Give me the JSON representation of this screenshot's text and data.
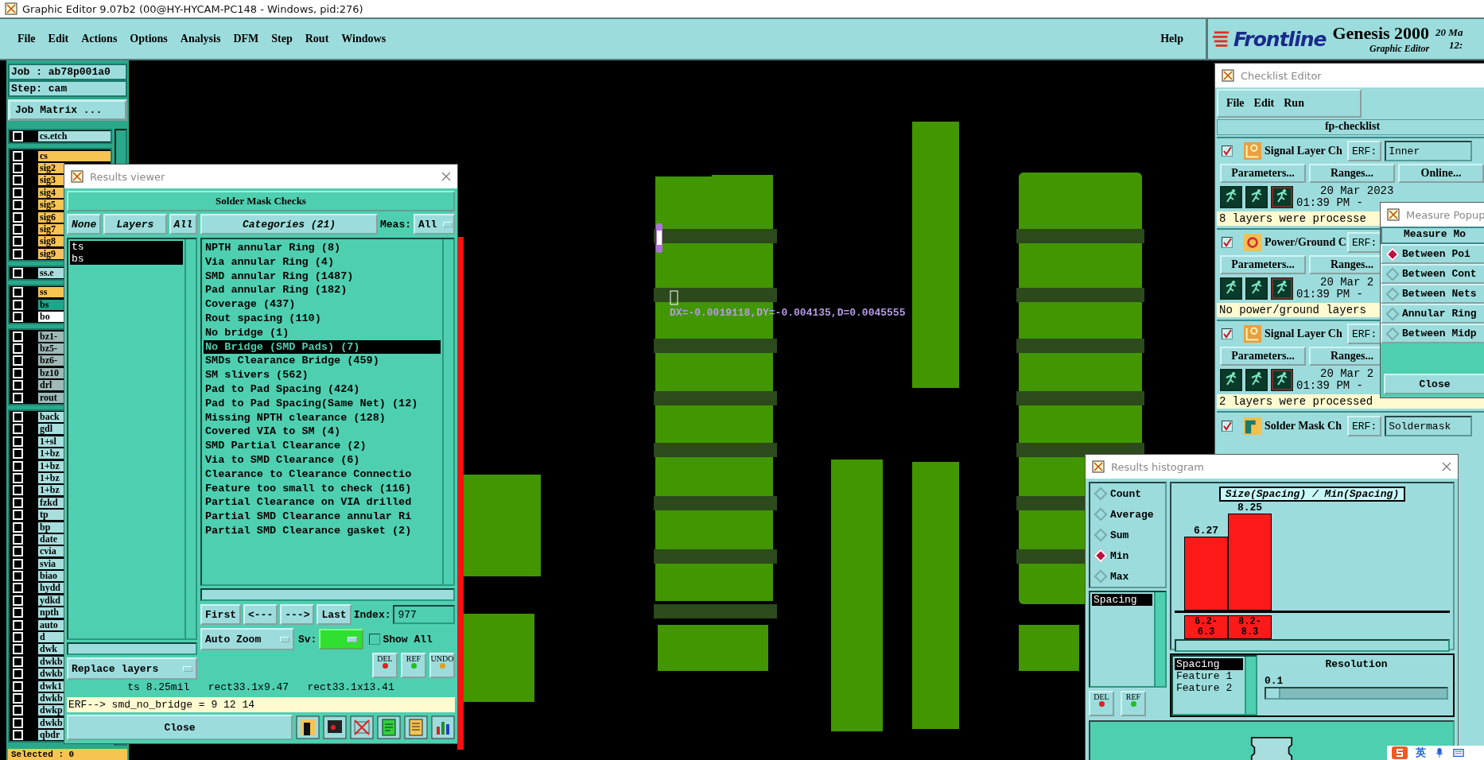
{
  "window": {
    "title": "Graphic Editor 9.07b2 (00@HY-HYCAM-PC148 - Windows, pid:276)"
  },
  "menu": [
    "File",
    "Edit",
    "Actions",
    "Options",
    "Analysis",
    "DFM",
    "Step",
    "Rout",
    "Windows"
  ],
  "help": "Help",
  "brand": {
    "logo": "Frontline",
    "product": "Genesis 2000",
    "subtitle": "Graphic Editor",
    "date": "20 Ma",
    "time": "12:"
  },
  "job": {
    "job": "Job : ab78p001a0",
    "step": "Step: cam",
    "matrix": "Job Matrix ..."
  },
  "layer_groups": [
    {
      "layers": [
        {
          "name": "cs.etch",
          "color": "#a8dede",
          "checked": false
        }
      ]
    },
    {
      "layers": [
        {
          "name": "cs",
          "color": "#f7c452",
          "checked": false
        },
        {
          "name": "sig2",
          "color": "#f7c452",
          "checked": false
        },
        {
          "name": "sig3",
          "color": "#f7c452",
          "checked": false
        },
        {
          "name": "sig4",
          "color": "#f7c452",
          "checked": false
        },
        {
          "name": "sig5",
          "color": "#f7c452",
          "checked": false
        },
        {
          "name": "sig6",
          "color": "#f7c452",
          "checked": false
        },
        {
          "name": "sig7",
          "color": "#f7c452",
          "checked": false
        },
        {
          "name": "sig8",
          "color": "#f7c452",
          "checked": false
        },
        {
          "name": "sig9",
          "color": "#f7c452",
          "checked": false
        }
      ]
    },
    {
      "layers": [
        {
          "name": "ss.e",
          "color": "#a8dede",
          "checked": false
        }
      ]
    },
    {
      "layers": [
        {
          "name": "ss",
          "color": "#f7c452",
          "checked": false
        },
        {
          "name": "bs",
          "color": "#1fa58a",
          "checked": false
        },
        {
          "name": "bo",
          "color": "#ffffff",
          "checked": false
        }
      ]
    },
    {
      "layers": [
        {
          "name": "bz1-",
          "color": "#9fb8b8",
          "checked": false
        },
        {
          "name": "bz5-",
          "color": "#9fb8b8",
          "checked": false
        },
        {
          "name": "bz6-",
          "color": "#9fb8b8",
          "checked": false
        },
        {
          "name": "bz10",
          "color": "#9fb8b8",
          "checked": false
        },
        {
          "name": "drl",
          "color": "#9fb8b8",
          "checked": false
        },
        {
          "name": "rout",
          "color": "#9fb8b8",
          "checked": false
        }
      ]
    },
    {
      "layers": [
        {
          "name": "back",
          "color": "#a8dede",
          "checked": false
        },
        {
          "name": "gdl",
          "color": "#a8dede",
          "checked": false
        },
        {
          "name": "1+sl",
          "color": "#a8dede",
          "checked": false
        },
        {
          "name": "1+bz",
          "color": "#a8dede",
          "checked": false
        },
        {
          "name": "1+bz",
          "color": "#a8dede",
          "checked": false
        },
        {
          "name": "1+bz",
          "color": "#a8dede",
          "checked": false
        },
        {
          "name": "1+bz",
          "color": "#a8dede",
          "checked": false
        },
        {
          "name": "fzkd",
          "color": "#a8dede",
          "checked": false
        },
        {
          "name": "tp",
          "color": "#a8dede",
          "checked": false
        },
        {
          "name": "bp",
          "color": "#a8dede",
          "checked": false
        },
        {
          "name": "date",
          "color": "#a8dede",
          "checked": false
        },
        {
          "name": "cvia",
          "color": "#a8dede",
          "checked": false
        },
        {
          "name": "svia",
          "color": "#a8dede",
          "checked": false
        },
        {
          "name": "biao",
          "color": "#a8dede",
          "checked": false
        },
        {
          "name": "hydd",
          "color": "#a8dede",
          "checked": false
        },
        {
          "name": "ydkd",
          "color": "#a8dede",
          "checked": false
        },
        {
          "name": "npth",
          "color": "#a8dede",
          "checked": false
        },
        {
          "name": "auto",
          "color": "#a8dede",
          "checked": false
        },
        {
          "name": "d",
          "color": "#a8dede",
          "checked": false
        },
        {
          "name": "dwk",
          "color": "#a8dede",
          "checked": false
        },
        {
          "name": "dwkb",
          "color": "#a8dede",
          "checked": false
        },
        {
          "name": "dwkb",
          "color": "#a8dede",
          "checked": false
        },
        {
          "name": "dwk1",
          "color": "#a8dede",
          "checked": false
        },
        {
          "name": "dwkb",
          "color": "#a8dede",
          "checked": false
        },
        {
          "name": "dwkp",
          "color": "#a8dede",
          "checked": false
        },
        {
          "name": "dwkb",
          "color": "#a8dede",
          "checked": false
        },
        {
          "name": "qbdr",
          "color": "#a8dede",
          "checked": false
        }
      ]
    }
  ],
  "selected_count": "Selected : 0",
  "canvas": {
    "measurement": "DX=-0.0019118,DY=-0.004135,D=0.0045555"
  },
  "results_viewer": {
    "title": "Results viewer",
    "header": "Solder Mask Checks",
    "layer_buttons": [
      "None",
      "Layers",
      "All"
    ],
    "layers": [
      {
        "name": "ts",
        "selected": true
      },
      {
        "name": "bs",
        "selected": true
      }
    ],
    "categories_button": "Categories (21)",
    "meas_label": "Meas:",
    "meas_value": "All",
    "categories": [
      {
        "label": "NPTH annular Ring (8)",
        "selected": false
      },
      {
        "label": "Via annular Ring (4)",
        "selected": false
      },
      {
        "label": "SMD annular Ring (1487)",
        "selected": false
      },
      {
        "label": "Pad annular Ring (182)",
        "selected": false
      },
      {
        "label": "Coverage (437)",
        "selected": false
      },
      {
        "label": "Rout spacing (110)",
        "selected": false
      },
      {
        "label": "No bridge (1)",
        "selected": false
      },
      {
        "label": "No Bridge (SMD Pads) (7)",
        "selected": true
      },
      {
        "label": "SMDs Clearance Bridge (459)",
        "selected": false
      },
      {
        "label": "SM slivers (562)",
        "selected": false
      },
      {
        "label": "Pad to Pad Spacing (424)",
        "selected": false
      },
      {
        "label": "Pad to Pad Spacing(Same Net) (12)",
        "selected": false
      },
      {
        "label": "Missing NPTH clearance (128)",
        "selected": false
      },
      {
        "label": "Covered VIA to SM (4)",
        "selected": false
      },
      {
        "label": "SMD Partial Clearance (2)",
        "selected": false
      },
      {
        "label": "Via to SMD Clearance (6)",
        "selected": false
      },
      {
        "label": "Clearance to Clearance Connectio",
        "selected": false
      },
      {
        "label": "Feature too small to check (116)",
        "selected": false
      },
      {
        "label": "Partial Clearance on VIA drilled",
        "selected": false
      },
      {
        "label": "Partial SMD Clearance annular Ri",
        "selected": false
      },
      {
        "label": "Partial SMD Clearance gasket (2)",
        "selected": false
      }
    ],
    "nav": [
      "First",
      "<---",
      "--->",
      "Last"
    ],
    "index_label": "Index:",
    "index_value": "977",
    "zoom_mode": "Auto Zoom",
    "sv_label": "Sv:",
    "show_all": {
      "label": "Show All",
      "checked": false
    },
    "replace": "Replace layers",
    "tool_buttons": [
      "DEL",
      "REF",
      "UNDO"
    ],
    "status": "ts 8.25mil   rect33.1x9.47   rect33.1x13.41",
    "erf": "ERF--> smd_no_bridge = 9 12 14",
    "close": "Close"
  },
  "checklist": {
    "title": "Checklist Editor",
    "menu": [
      "File",
      "Edit",
      "Run"
    ],
    "name": "fp-checklist",
    "entries": [
      {
        "kind": "signal",
        "checked": true,
        "name": "Signal Layer Ch",
        "erf": "ERF:",
        "erf_value": "Inner",
        "buttons": [
          "Parameters...",
          "Ranges...",
          "Online..."
        ],
        "date": "20 Mar 2023",
        "time": "01:39 PM -",
        "message": "8 layers were processe"
      },
      {
        "kind": "power",
        "checked": true,
        "name": "Power/Ground C",
        "erf": "ERF:",
        "buttons": [
          "Parameters...",
          "Ranges..."
        ],
        "date": "20 Mar 2",
        "time": "01:39 PM -",
        "message": "No power/ground layers"
      },
      {
        "kind": "signal",
        "checked": true,
        "name": "Signal Layer Ch",
        "erf": "ERF:",
        "buttons": [
          "Parameters...",
          "Ranges..."
        ],
        "date": "20 Mar 2",
        "time": "01:39 PM -",
        "message": "2 layers were processed"
      },
      {
        "kind": "mask",
        "checked": true,
        "name": "Solder Mask Ch",
        "erf": "ERF:",
        "erf_value": "Soldermask"
      }
    ]
  },
  "measure_popup": {
    "title": "Measure Popup",
    "header": "Measure Mo",
    "modes": [
      {
        "label": "Between Poi",
        "selected": true
      },
      {
        "label": "Between Cont",
        "selected": false
      },
      {
        "label": "Between Nets",
        "selected": false
      },
      {
        "label": "Annular Ring",
        "selected": false
      },
      {
        "label": "Between Midp",
        "selected": false
      }
    ],
    "close": "Close"
  },
  "histogram": {
    "title": "Results histogram",
    "stats": [
      {
        "label": "Count",
        "selected": false
      },
      {
        "label": "Average",
        "selected": false
      },
      {
        "label": "Sum",
        "selected": false
      },
      {
        "label": "Min",
        "selected": true
      },
      {
        "label": "Max",
        "selected": false
      }
    ],
    "attributes": [
      {
        "label": "Spacing",
        "selected": true
      }
    ],
    "tool_buttons": [
      "DEL",
      "REF"
    ],
    "chart_data": {
      "type": "bar",
      "title": "Size(Spacing) / Min(Spacing)",
      "categories": [
        "6.2-6.3",
        "8.2-8.3"
      ],
      "values": [
        6.27,
        8.25
      ],
      "data_labels": true
    },
    "fields": [
      {
        "label": "Spacing",
        "selected": true
      },
      {
        "label": "Feature 1",
        "selected": false
      },
      {
        "label": "Feature 2",
        "selected": false
      }
    ],
    "resolution_label": "Resolution",
    "resolution_value": "0.1",
    "resolution": {
      "level": 0.07
    }
  },
  "ime": {
    "mode": "英"
  }
}
